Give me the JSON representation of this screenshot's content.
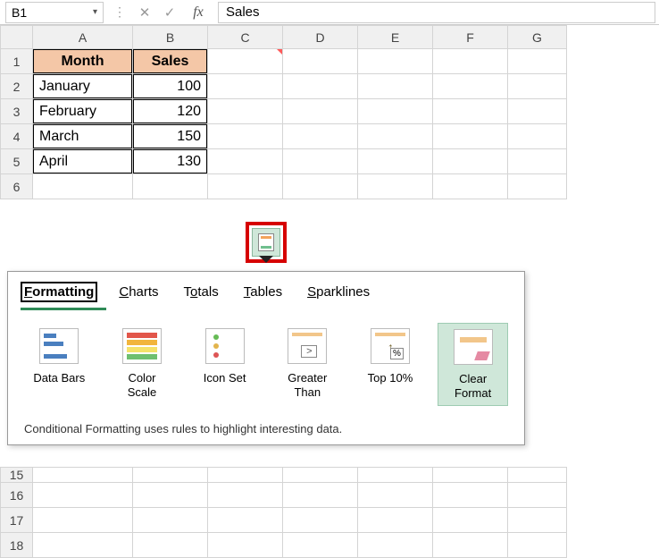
{
  "formula_bar": {
    "cell_ref": "B1",
    "fx_label": "fx",
    "value": "Sales"
  },
  "columns": [
    "A",
    "B",
    "C",
    "D",
    "E",
    "F",
    "G"
  ],
  "rows_before": [
    1,
    2,
    3,
    4,
    5,
    6
  ],
  "rows_after": [
    15,
    16,
    17,
    18
  ],
  "table": {
    "headers": {
      "month": "Month",
      "sales": "Sales"
    },
    "data": [
      {
        "month": "January",
        "sales": "100"
      },
      {
        "month": "February",
        "sales": "120"
      },
      {
        "month": "March",
        "sales": "150"
      },
      {
        "month": "April",
        "sales": "130"
      }
    ]
  },
  "panel": {
    "tabs": {
      "formatting": {
        "u": "F",
        "rest": "ormatting"
      },
      "charts": {
        "u": "C",
        "rest": "harts"
      },
      "totals": {
        "pre": "T",
        "u": "o",
        "rest": "tals"
      },
      "tables": {
        "u": "T",
        "rest": "ables"
      },
      "sparklines": {
        "u": "S",
        "rest": "parklines"
      }
    },
    "options": {
      "databars": "Data Bars",
      "colorscale_l1": "Color",
      "colorscale_l2": "Scale",
      "iconset": "Icon Set",
      "greater_l1": "Greater",
      "greater_l2": "Than",
      "top10": "Top 10%",
      "clear_l1": "Clear",
      "clear_l2": "Format",
      "gt_sym": ">",
      "pct_sym": "%",
      "arrow_sym": "↑"
    },
    "description": "Conditional Formatting uses rules to highlight interesting data."
  }
}
